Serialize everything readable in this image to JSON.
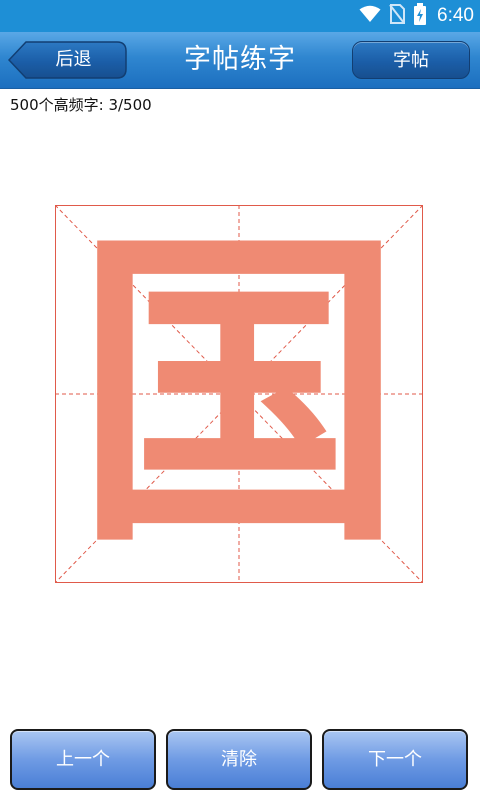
{
  "status_bar": {
    "time": "6:40",
    "icons": [
      "wifi-icon",
      "no-sim-icon",
      "battery-charging-icon"
    ]
  },
  "header": {
    "title": "字帖练字",
    "back_label": "后退",
    "copybook_label": "字帖"
  },
  "progress": {
    "text": "500个高频字: 3/500"
  },
  "practice": {
    "character": "国",
    "stroke_color": "#ef8a73",
    "grid_color": "#e05a4a"
  },
  "footer": {
    "prev_label": "上一个",
    "clear_label": "清除",
    "next_label": "下一个"
  },
  "colors": {
    "status_bar": "#1e8fd6",
    "title_bar": "#2f86d0",
    "button_blue": "#6f9be4"
  }
}
